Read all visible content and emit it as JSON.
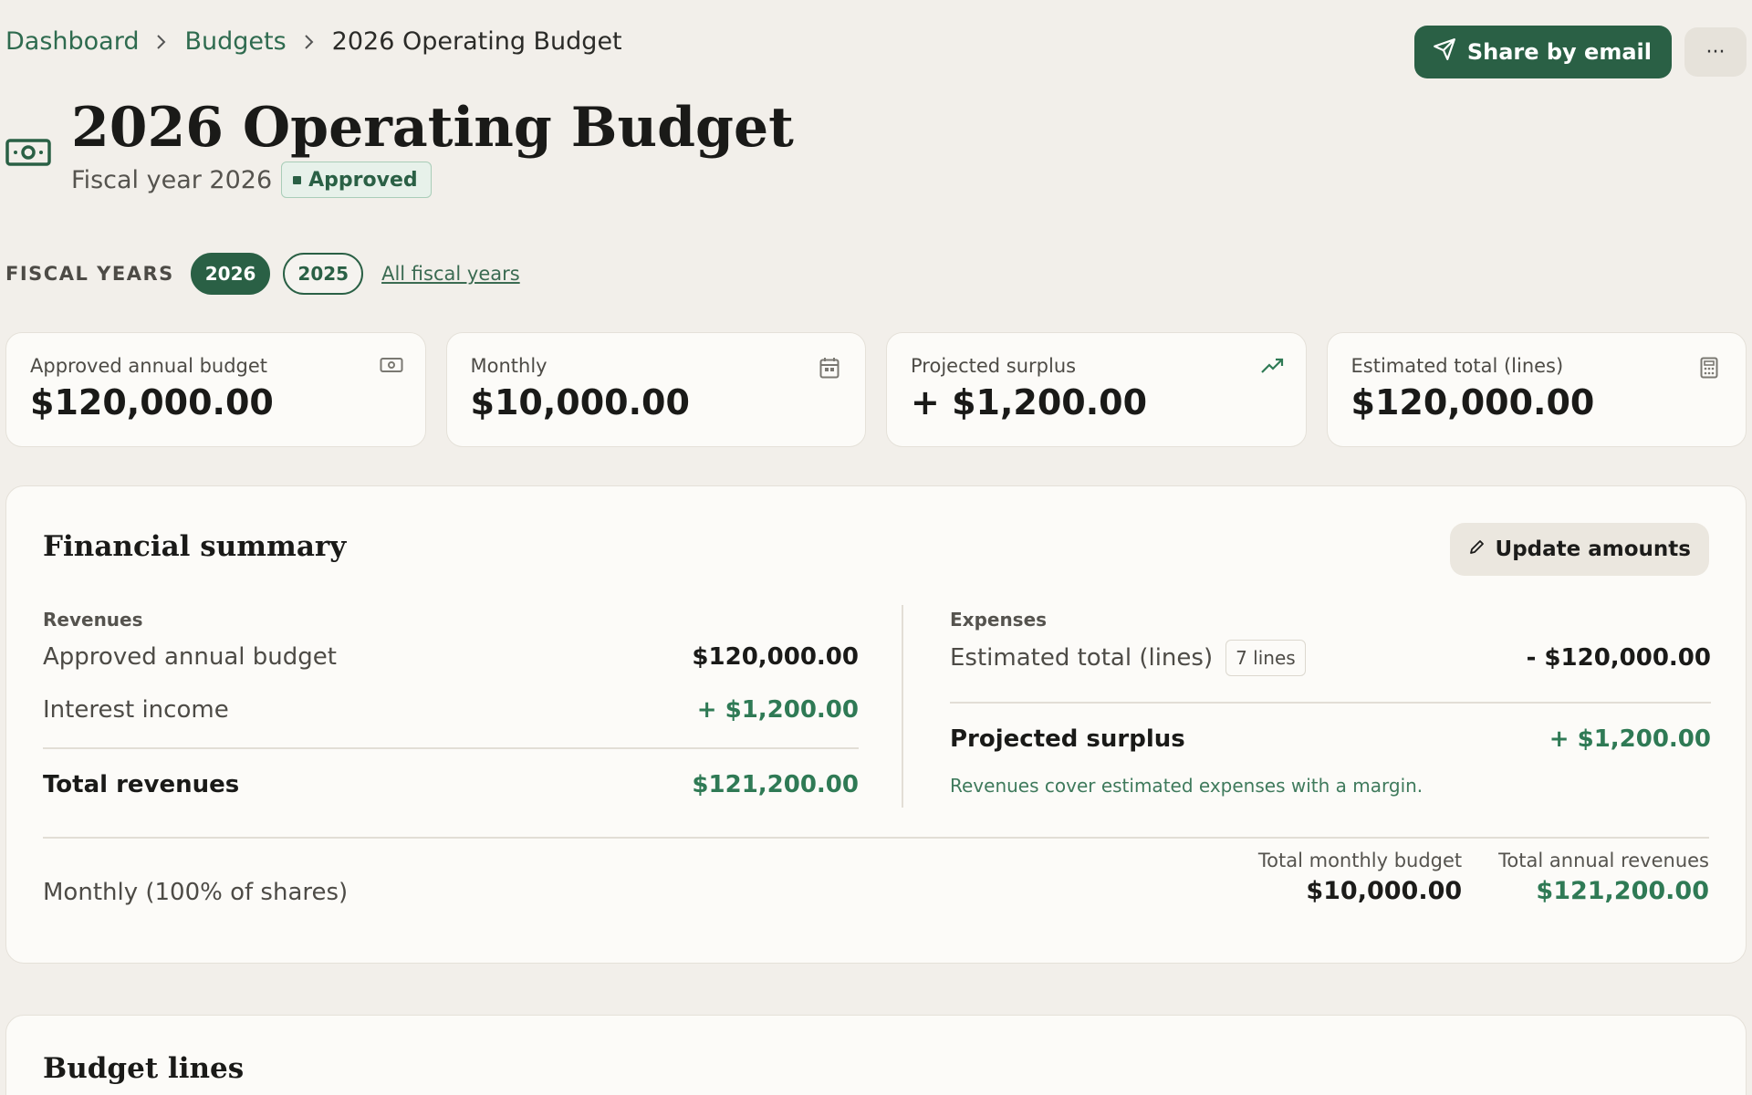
{
  "breadcrumb": {
    "items": [
      "Dashboard",
      "Budgets"
    ],
    "current": "2026 Operating Budget"
  },
  "actions": {
    "share_label": "Share by email",
    "more_label": "···"
  },
  "header": {
    "title": "2026 Operating Budget",
    "subtitle": "Fiscal year 2026",
    "status": "Approved"
  },
  "fiscal_years": {
    "label": "FISCAL YEARS",
    "years": [
      "2026",
      "2025"
    ],
    "selected": "2026",
    "all_link": "All fiscal years"
  },
  "kpis": [
    {
      "label": "Approved annual budget",
      "value": "$120,000.00",
      "icon": "money-icon"
    },
    {
      "label": "Monthly",
      "value": "$10,000.00",
      "icon": "calendar-icon"
    },
    {
      "label": "Projected surplus",
      "value": "+ $1,200.00",
      "icon": "trend-up-icon"
    },
    {
      "label": "Estimated total (lines)",
      "value": "$120,000.00",
      "icon": "calculator-icon"
    }
  ],
  "summary": {
    "title": "Financial summary",
    "update_label": "Update amounts",
    "revenues": {
      "label": "Revenues",
      "rows": [
        {
          "label": "Approved annual budget",
          "value": "$120,000.00"
        },
        {
          "label": "Interest income",
          "value": "+ $1,200.00"
        }
      ],
      "total_label": "Total revenues",
      "total_value": "$121,200.00"
    },
    "expenses": {
      "label": "Expenses",
      "row_label": "Estimated total (lines)",
      "lines_badge": "7 lines",
      "row_value": "- $120,000.00",
      "surplus_label": "Projected surplus",
      "surplus_value": "+ $1,200.00",
      "note": "Revenues cover estimated expenses with a margin."
    },
    "footer": {
      "label": "Monthly (100% of shares)",
      "monthly_label": "Total monthly budget",
      "monthly_value": "$10,000.00",
      "annual_label": "Total annual revenues",
      "annual_value": "$121,200.00"
    }
  },
  "budget_lines": {
    "title": "Budget lines"
  },
  "colors": {
    "accent": "#2a6045",
    "positive": "#2f7a55",
    "background": "#f2efea",
    "card": "#fcfbf8"
  }
}
